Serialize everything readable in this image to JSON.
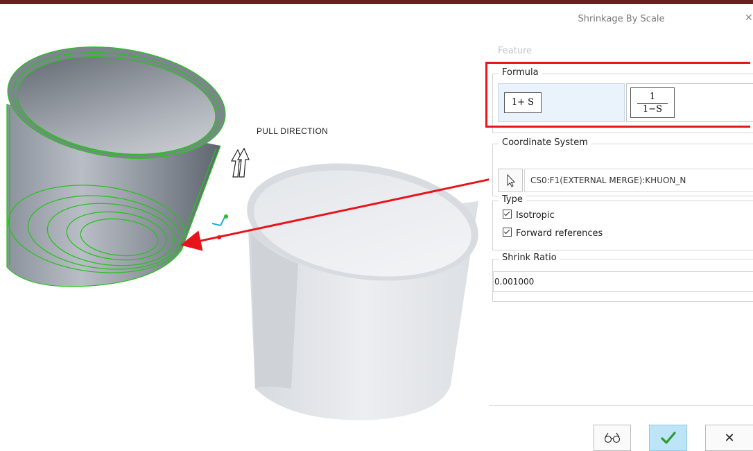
{
  "viewport": {
    "pull_direction_label": "PULL DIRECTION"
  },
  "dialog": {
    "title": "Shrinkage By Scale",
    "close_icon": "close-icon",
    "feature_label": "Feature",
    "formula": {
      "title": "Formula",
      "option_a": "1+ S",
      "option_b_numerator": "1",
      "option_b_denominator": "1−S"
    },
    "coordinate_system": {
      "title": "Coordinate System",
      "select_icon": "arrow-cursor-icon",
      "value": "CS0:F1(EXTERNAL MERGE):KHUON_N"
    },
    "type": {
      "title": "Type",
      "isotropic_label": "Isotropic",
      "isotropic_checked": true,
      "forward_refs_label": "Forward references",
      "forward_refs_checked": true
    },
    "shrink_ratio": {
      "title": "Shrink Ratio",
      "value": "0.001000"
    },
    "buttons": {
      "preview_icon": "glasses-icon",
      "ok_icon": "checkmark-icon",
      "cancel_label": "✕"
    }
  },
  "colors": {
    "highlight": "#e8141b",
    "arrow": "#e8141b",
    "ok_button": "#bde5f7",
    "top_bar": "#6b1f1f",
    "selection_edges": "#27c21f"
  }
}
